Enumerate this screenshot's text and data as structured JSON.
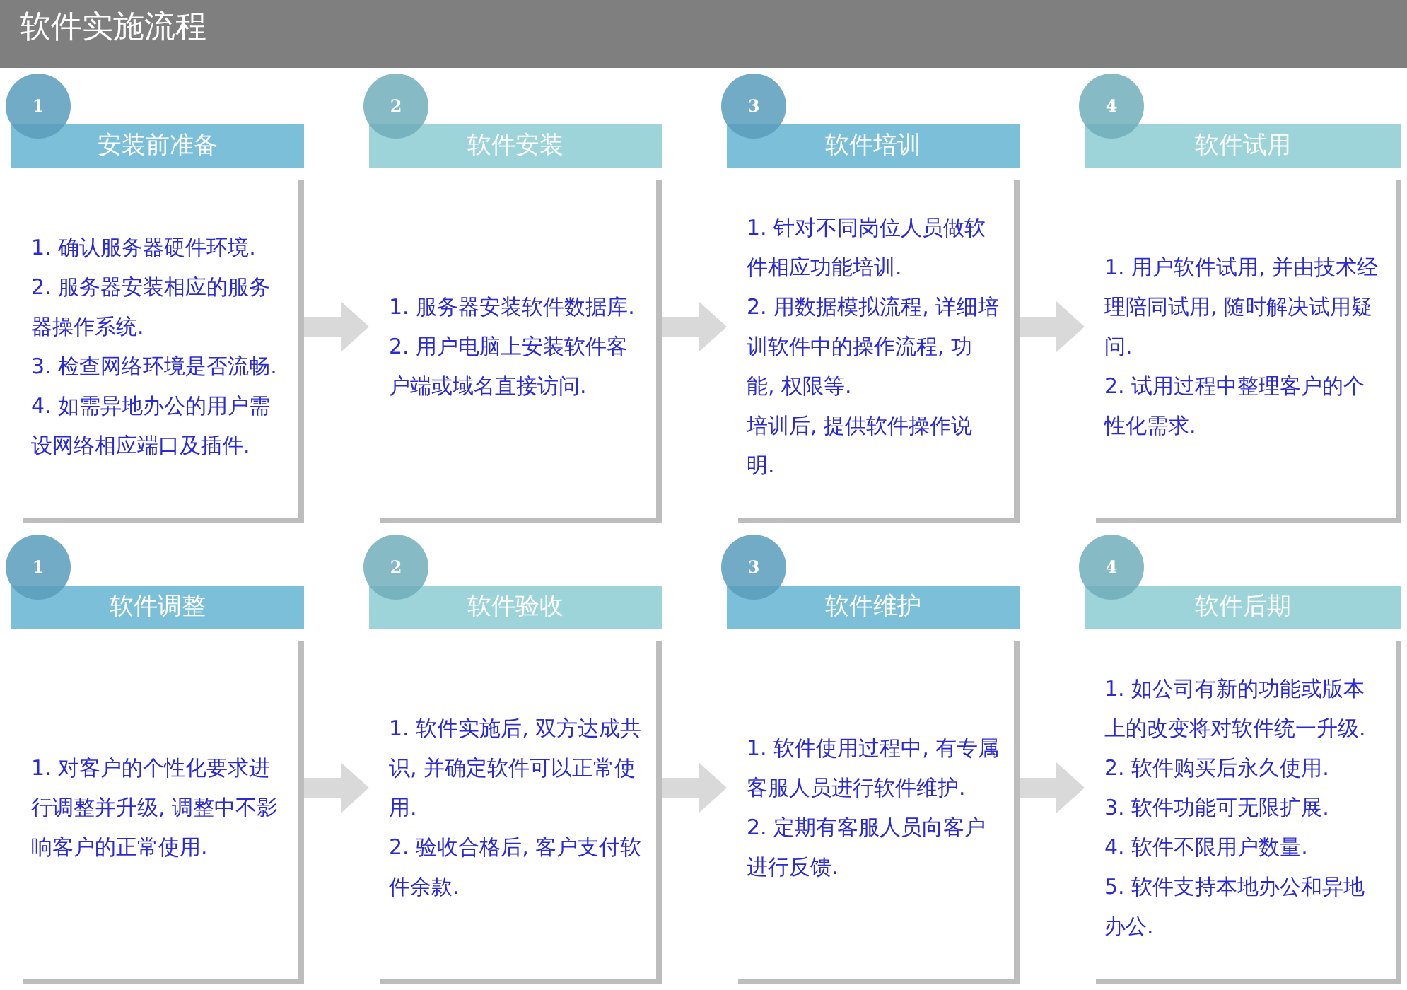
{
  "title": "软件实施流程",
  "rows": [
    {
      "steps": [
        {
          "number": "1",
          "heading": "安装前准备",
          "color": "#7bbfd9",
          "items": [
            "1. 确认服务器硬件环境.",
            "2. 服务器安装相应的服务器操作系统.",
            "3. 检查网络环境是否流畅.",
            "4. 如需异地办公的用户需设网络相应端口及插件."
          ]
        },
        {
          "number": "2",
          "heading": "软件安装",
          "color": "#9dd4d9",
          "items": [
            "1. 服务器安装软件数据库.",
            "2. 用户电脑上安装软件客户端或域名直接访问."
          ]
        },
        {
          "number": "3",
          "heading": "软件培训",
          "color": "#7bbfd9",
          "items": [
            "1. 针对不同岗位人员做软件相应功能培训.",
            "2. 用数据模拟流程, 详细培训软件中的操作流程, 功能, 权限等.",
            "培训后, 提供软件操作说明."
          ]
        },
        {
          "number": "4",
          "heading": "软件试用",
          "color": "#9dd4d9",
          "items": [
            "1. 用户软件试用, 并由技术经理陪同试用, 随时解决试用疑问.",
            "2. 试用过程中整理客户的个性化需求."
          ]
        }
      ]
    },
    {
      "steps": [
        {
          "number": "1",
          "heading": "软件调整",
          "color": "#7bbfd9",
          "items": [
            "1. 对客户的个性化要求进行调整并升级, 调整中不影响客户的正常使用."
          ]
        },
        {
          "number": "2",
          "heading": "软件验收",
          "color": "#9dd4d9",
          "items": [
            "1. 软件实施后, 双方达成共识, 并确定软件可以正常使用.",
            "2. 验收合格后, 客户支付软件余款."
          ]
        },
        {
          "number": "3",
          "heading": "软件维护",
          "color": "#7bbfd9",
          "items": [
            "1. 软件使用过程中, 有专属客服人员进行软件维护.",
            "2. 定期有客服人员向客户进行反馈."
          ]
        },
        {
          "number": "4",
          "heading": "软件后期",
          "color": "#9dd4d9",
          "items": [
            "1. 如公司有新的功能或版本上的改变将对软件统一升级.",
            "2. 软件购买后永久使用.",
            "3. 软件功能可无限扩展.",
            "4. 软件不限用户数量.",
            "5. 软件支持本地办公和异地办公."
          ]
        }
      ]
    }
  ]
}
